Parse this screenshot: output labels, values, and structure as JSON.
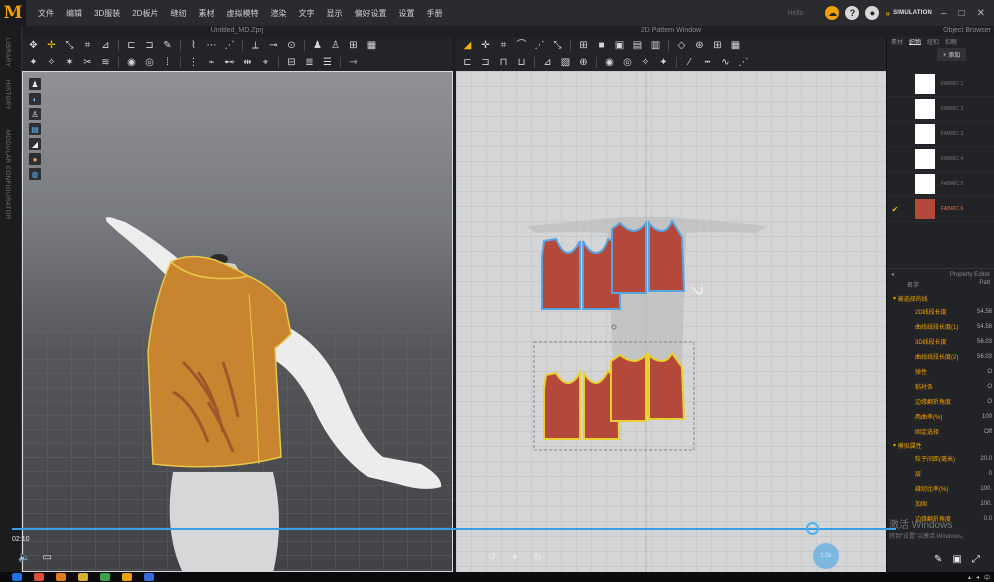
{
  "app": {
    "logo": "M",
    "mode_label": "Hello",
    "simulation_label": "SIMULATION"
  },
  "menu": [
    "文件",
    "编辑",
    "3D服装",
    "2D板片",
    "缝纫",
    "素材",
    "虚拟模特",
    "渲染",
    "文字",
    "显示",
    "偏好设置",
    "设置",
    "手册"
  ],
  "windows": {
    "title_3d": "Untitled_MD.Zprj",
    "title_2d": "2D Pattern Window",
    "title_object_browser": "Object Browser"
  },
  "left_tabs": [
    "LIBRARY",
    "HISTORY",
    "MODULAR CONFIGURATOR"
  ],
  "object_browser": {
    "tabs": [
      "素材",
      "织物",
      "纽扣",
      "扣眼"
    ],
    "active_tab": 1,
    "add_label": "+ 添加",
    "fabrics": [
      {
        "name": "FABRIC 1",
        "color": "#ffffff",
        "selected": false
      },
      {
        "name": "FABRIC 2",
        "color": "#ffffff",
        "selected": false
      },
      {
        "name": "FABRIC 3",
        "color": "#ffffff",
        "selected": false
      },
      {
        "name": "FABRIC 4",
        "color": "#ffffff",
        "selected": false
      },
      {
        "name": "FABRIC 5",
        "color": "#ffffff",
        "selected": false
      },
      {
        "name": "FABRIC 6",
        "color": "#b4483a",
        "selected": true
      }
    ]
  },
  "property_editor": {
    "title": "Property Editor",
    "col_name": "名字",
    "col_value": "Patt",
    "section_1": "被选择的线",
    "rows_1": [
      {
        "label": "2D线段长度",
        "value": "54.58"
      },
      {
        "label": "曲线线段长度(1)",
        "value": "54.58"
      },
      {
        "label": "3D线段长度",
        "value": "56.03"
      },
      {
        "label": "曲线线段长度(2)",
        "value": "56.03"
      },
      {
        "label": "弹性",
        "value": "O"
      },
      {
        "label": "粘衬条",
        "value": "O"
      },
      {
        "label": "边缘翻折角度",
        "value": "O"
      },
      {
        "label": "两曲率(%)",
        "value": "100"
      },
      {
        "label": "固定选择",
        "value": "Off"
      }
    ],
    "section_2": "模拟属性",
    "rows_2": [
      {
        "label": "粒子间距(毫米)",
        "value": "20.0"
      },
      {
        "label": "层",
        "value": "0"
      },
      {
        "label": "缝纫比率(%)",
        "value": "100."
      },
      {
        "label": "加固",
        "value": "100."
      },
      {
        "label": "边缘翻折角度",
        "value": "0.0"
      }
    ]
  },
  "video": {
    "current_time": "02:10",
    "progress": 0.905,
    "speed_label": "1.0x",
    "watermark": "激活 Windows",
    "watermark_sub": "转到“设置”以激活 Windows。"
  },
  "tray": {
    "lang": "中"
  },
  "colors": {
    "accent": "#f0a000",
    "fabric": "#b4483a",
    "progress": "#35a0e8",
    "garment": "#c9842f"
  }
}
